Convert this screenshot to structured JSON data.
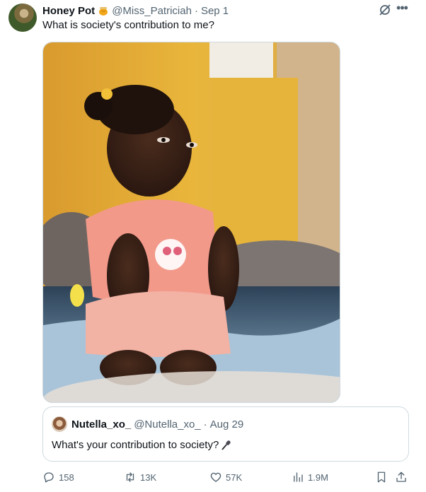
{
  "author": {
    "display_name": "Honey Pot",
    "handle": "@Miss_Patriciah",
    "separator": "·",
    "time": "Sep 1"
  },
  "tweet": {
    "text": "What is society's contribution to me?"
  },
  "media": {
    "description_icon": "photo"
  },
  "quoted_tweet": {
    "display_name": "Nutella_xo_",
    "handle": "@Nutella_xo_",
    "separator": "·",
    "time": "Aug 29",
    "text": "What's your contribution to society?"
  },
  "actions": {
    "replies": "158",
    "retweets": "13K",
    "likes": "57K",
    "views": "1.9M"
  },
  "colors": {
    "text_primary": "#0f1419",
    "text_secondary": "#536471",
    "border": "#cfd9de"
  }
}
